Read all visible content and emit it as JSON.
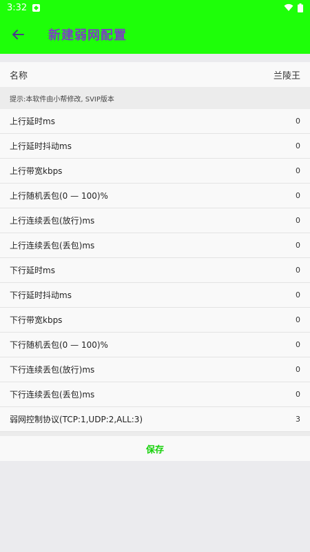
{
  "status_bar": {
    "time": "3:32",
    "notification_icon": "notification-icon",
    "wifi_icon": "wifi-icon",
    "battery_icon": "battery-icon"
  },
  "app_bar": {
    "title": "新建弱网配置",
    "back_icon": "arrow-left-icon"
  },
  "name_row": {
    "label": "名称",
    "value": "兰陵王"
  },
  "hint": "提示:本软件由小帮修改, SVIP版本",
  "rows": [
    {
      "label": "上行延时ms",
      "value": "0"
    },
    {
      "label": "上行延时抖动ms",
      "value": "0"
    },
    {
      "label": "上行带宽kbps",
      "value": "0"
    },
    {
      "label": "上行随机丢包(0 — 100)%",
      "value": "0"
    },
    {
      "label": "上行连续丢包(放行)ms",
      "value": "0"
    },
    {
      "label": "上行连续丢包(丢包)ms",
      "value": "0"
    },
    {
      "label": "下行延时ms",
      "value": "0"
    },
    {
      "label": "下行延时抖动ms",
      "value": "0"
    },
    {
      "label": "下行带宽kbps",
      "value": "0"
    },
    {
      "label": "下行随机丢包(0 — 100)%",
      "value": "0"
    },
    {
      "label": "下行连续丢包(放行)ms",
      "value": "0"
    },
    {
      "label": "下行连续丢包(丢包)ms",
      "value": "0"
    },
    {
      "label": "弱网控制协议(TCP:1,UDP:2,ALL:3)",
      "value": "3"
    }
  ],
  "save_label": "保存",
  "colors": {
    "accent": "#1eff09",
    "title": "#7b3fc2",
    "save": "#16d10a"
  }
}
